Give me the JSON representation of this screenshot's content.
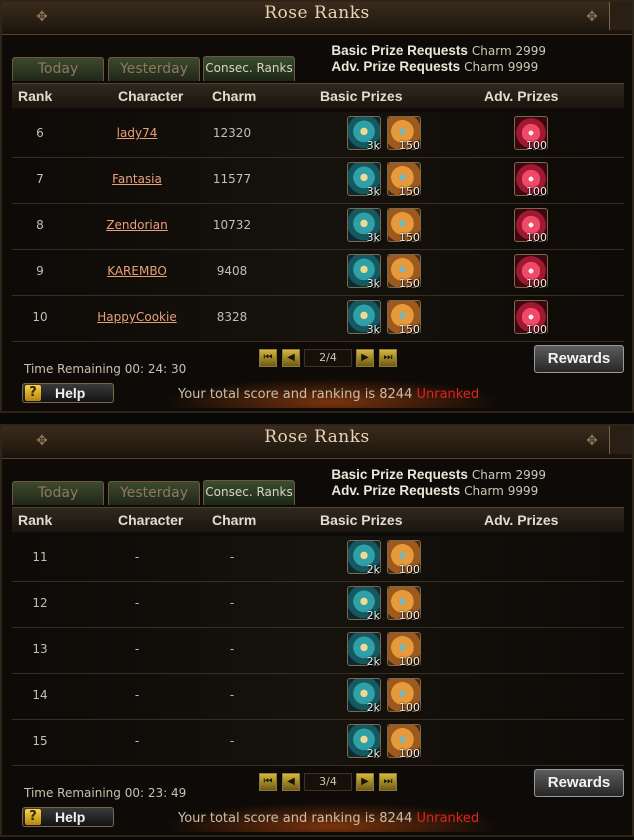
{
  "panels": [
    {
      "title": "Rose Ranks",
      "tabs": [
        "Today",
        "Yesterday",
        "Consec. Ranks"
      ],
      "basic_prize_label": "Basic Prize Requests",
      "basic_prize_value": "Charm 2999",
      "adv_prize_label": "Adv. Prize Requests",
      "adv_prize_value": "Charm 9999",
      "columns": [
        "Rank",
        "Character",
        "Charm",
        "Basic Prizes",
        "Adv. Prizes"
      ],
      "rows": [
        {
          "rank": "6",
          "character": "lady74",
          "charm": "12320",
          "basic": [
            "3k",
            "150"
          ],
          "adv": "100"
        },
        {
          "rank": "7",
          "character": "Fantasia",
          "charm": "11577",
          "basic": [
            "3k",
            "150"
          ],
          "adv": "100"
        },
        {
          "rank": "8",
          "character": "Zendorian",
          "charm": "10732",
          "basic": [
            "3k",
            "150"
          ],
          "adv": "100"
        },
        {
          "rank": "9",
          "character": "KAREMBO",
          "charm": "9408",
          "basic": [
            "3k",
            "150"
          ],
          "adv": "100"
        },
        {
          "rank": "10",
          "character": "HappyCookie",
          "charm": "8328",
          "basic": [
            "3k",
            "150"
          ],
          "adv": "100"
        }
      ],
      "time_remaining": "Time Remaining 00: 24: 30",
      "page": "2/4",
      "rewards_label": "Rewards",
      "help_label": "Help",
      "score_text": "Your total score and ranking is",
      "score_value": "8244",
      "ranking": "Unranked"
    },
    {
      "title": "Rose Ranks",
      "tabs": [
        "Today",
        "Yesterday",
        "Consec. Ranks"
      ],
      "basic_prize_label": "Basic Prize Requests",
      "basic_prize_value": "Charm 2999",
      "adv_prize_label": "Adv. Prize Requests",
      "adv_prize_value": "Charm 9999",
      "columns": [
        "Rank",
        "Character",
        "Charm",
        "Basic Prizes",
        "Adv. Prizes"
      ],
      "rows": [
        {
          "rank": "11",
          "character": "-",
          "charm": "-",
          "basic": [
            "2k",
            "100"
          ],
          "adv": ""
        },
        {
          "rank": "12",
          "character": "-",
          "charm": "-",
          "basic": [
            "2k",
            "100"
          ],
          "adv": ""
        },
        {
          "rank": "13",
          "character": "-",
          "charm": "-",
          "basic": [
            "2k",
            "100"
          ],
          "adv": ""
        },
        {
          "rank": "14",
          "character": "-",
          "charm": "-",
          "basic": [
            "2k",
            "100"
          ],
          "adv": ""
        },
        {
          "rank": "15",
          "character": "-",
          "charm": "-",
          "basic": [
            "2k",
            "100"
          ],
          "adv": ""
        }
      ],
      "time_remaining": "Time Remaining 00: 23: 49",
      "page": "3/4",
      "rewards_label": "Rewards",
      "help_label": "Help",
      "score_text": "Your total score and ranking is",
      "score_value": "8244",
      "ranking": "Unranked"
    }
  ],
  "icons": {
    "basic_prize_1": "chest-icon",
    "basic_prize_2": "scroll-icon",
    "adv_prize": "gem-icon"
  },
  "colors": {
    "character_link": "#e9a07a",
    "ranking_text": "#e0241a"
  }
}
